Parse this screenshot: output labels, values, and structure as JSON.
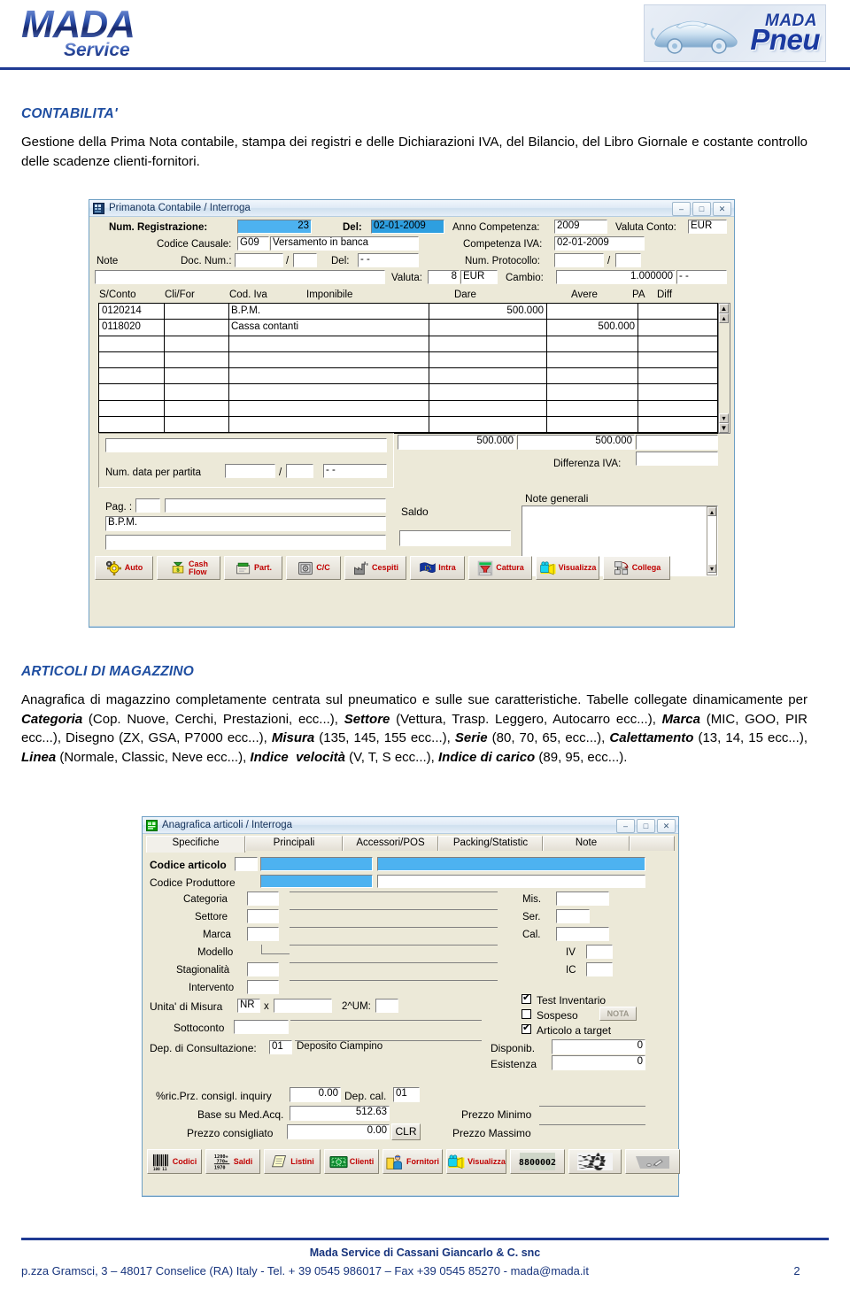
{
  "header": {
    "logo_left_main": "MADA",
    "logo_left_sub": "Service",
    "logo_right_top": "MADA",
    "logo_right_main": "Pneu",
    "car_icon": "sports-car-icon"
  },
  "sections": [
    {
      "id": "contabilita",
      "title": "CONTABILITA'",
      "body_html": "Gestione della Prima Nota contabile, stampa dei registri e delle Dichiarazioni IVA, del Bilancio, del Libro Giornale e costante controllo delle scadenze clienti-fornitori."
    },
    {
      "id": "articoli",
      "title": "ARTICOLI DI MAGAZZINO",
      "body_html": "Anagrafica di magazzino completamente centrata sul pneumatico e sulle sue caratteristiche. Tabelle collegate dinamicamente per <b>Categoria</b> (Cop. Nuove, Cerchi, Prestazioni, ecc...), <b>Settore</b> (Vettura, Trasp. Leggero, Autocarro ecc...), <b>Marca</b> (MIC, GOO, PIR ecc...), Disegno (ZX, GSA, P7000 ecc...), <b>Misura</b> (135, 145, 155 ecc...), <b>Serie</b> (80, 70, 65, ecc...), <b>Calettamento</b> (13, 14, 15 ecc...), <b>Linea</b> (Normale, Classic, Neve ecc...), <b>Indice&nbsp; velocit&agrave;</b> (V, T, S ecc...), <b>Indice di carico</b> (89, 95, ecc...)."
    }
  ],
  "window_primanota": {
    "title": "Primanota Contabile / Interroga",
    "window_icon": "app-grid-icon",
    "buttons": {
      "minimize": "–",
      "maximize": "□",
      "close": "✕"
    },
    "fields": {
      "num_registrazione_label": "Num. Registrazione:",
      "num_registrazione_value": "23",
      "del_label": "Del:",
      "del_value": "02-01-2009",
      "anno_competenza_label": "Anno Competenza:",
      "anno_competenza_value": "2009",
      "valuta_conto_label": "Valuta Conto:",
      "valuta_conto_value": "EUR",
      "codice_causale_label": "Codice Causale:",
      "codice_causale_code": "G09",
      "codice_causale_desc": "Versamento in banca",
      "competenza_iva_label": "Competenza IVA:",
      "competenza_iva_value": "02-01-2009",
      "note_label": "Note",
      "doc_num_label": "Doc. Num.:",
      "doc_num_value": "",
      "doc_num_slash": "/",
      "doc_num_value2": "",
      "doc_del_label": "Del:",
      "doc_del_value": "- -",
      "num_protocollo_label": "Num. Protocollo:",
      "num_protocollo_value": "",
      "num_protocollo_slash": "/",
      "num_protocollo_value2": "",
      "note_value": "",
      "valuta_label": "Valuta:",
      "valuta_num": "8",
      "valuta_code": "EUR",
      "cambio_label": "Cambio:",
      "cambio_value": "1.000000",
      "cambio_date": "- -"
    },
    "table": {
      "headers": [
        "S/Conto",
        "Cli/For",
        "Cod. Iva",
        "Imponibile",
        "Dare",
        "Avere",
        "PA",
        "Diff"
      ],
      "rows": [
        {
          "sconto": "0120214",
          "clifor": "",
          "codiva": "B.P.M.",
          "dare": "500.000",
          "avere": "",
          "pa": ""
        },
        {
          "sconto": "0118020",
          "clifor": "",
          "codiva": "Cassa contanti",
          "dare": "",
          "avere": "500.000",
          "pa": ""
        },
        {
          "sconto": "",
          "clifor": "",
          "codiva": "",
          "dare": "",
          "avere": "",
          "pa": ""
        },
        {
          "sconto": "",
          "clifor": "",
          "codiva": "",
          "dare": "",
          "avere": "",
          "pa": ""
        },
        {
          "sconto": "",
          "clifor": "",
          "codiva": "",
          "dare": "",
          "avere": "",
          "pa": ""
        },
        {
          "sconto": "",
          "clifor": "",
          "codiva": "",
          "dare": "",
          "avere": "",
          "pa": ""
        },
        {
          "sconto": "",
          "clifor": "",
          "codiva": "",
          "dare": "",
          "avere": "",
          "pa": ""
        },
        {
          "sconto": "",
          "clifor": "",
          "codiva": "",
          "dare": "",
          "avere": "",
          "pa": ""
        }
      ],
      "total_dare": "500.000",
      "total_avere": "500.000"
    },
    "footer_fields": {
      "num_data_partita_label": "Num. data per partita",
      "num_data_partita_v1": "",
      "num_data_partita_slash": "/",
      "num_data_partita_v2": "",
      "num_data_partita_date": "- -",
      "differenza_iva_label": "Differenza IVA:",
      "differenza_iva_value": "",
      "note_generali_label": "Note generali",
      "note_generali_value": "",
      "pag_label": "Pag. :",
      "pag_code": "",
      "pag_desc": "",
      "bpm_value": "B.P.M.",
      "extra_value": "",
      "saldo_label": "Saldo",
      "saldo_value": ""
    },
    "toolbar": [
      {
        "label": "Auto",
        "icon": "gear-icon"
      },
      {
        "label": "Cash Flow",
        "icon": "money-bag-icon"
      },
      {
        "label": "Part.",
        "icon": "card-file-icon"
      },
      {
        "label": "C/C",
        "icon": "safe-icon"
      },
      {
        "label": "Cespiti",
        "icon": "factory-icon"
      },
      {
        "label": "Intra",
        "icon": "eu-flag-icon"
      },
      {
        "label": "Cattura",
        "icon": "funnel-capture-icon"
      },
      {
        "label": "Visualizza",
        "icon": "camcorder-icon"
      },
      {
        "label": "Collega",
        "icon": "link-arrow-icon"
      }
    ]
  },
  "window_anagrafica": {
    "title": "Anagrafica articoli / Interroga",
    "window_icon": "green-card-icon",
    "buttons": {
      "minimize": "–",
      "maximize": "□",
      "close": "✕"
    },
    "tabs": [
      "Specifiche",
      "Principali",
      "Accessori/POS",
      "Packing/Statistic",
      "Note"
    ],
    "active_tab": "Specifiche",
    "fields": {
      "codice_articolo_label": "Codice articolo",
      "codice_articolo_v1": "",
      "codice_articolo_v2": "",
      "codice_articolo_v3": "",
      "codice_produttore_label": "Codice Produttore",
      "codice_produttore_v1": "",
      "codice_produttore_v2": "",
      "categoria_label": "Categoria",
      "settore_label": "Settore",
      "marca_label": "Marca",
      "modello_label": "Modello",
      "stagionalita_label": "Stagionalità",
      "intervento_label": "Intervento",
      "mis_label": "Mis.",
      "ser_label": "Ser.",
      "cal_label": "Cal.",
      "iv_label": "IV",
      "ic_label": "IC",
      "test_inventario_label": "Test Inventario",
      "test_inventario_checked": true,
      "sospeso_label": "Sospeso",
      "sospeso_checked": false,
      "nota_button_label": "NOTA",
      "articolo_target_label": "Articolo a target",
      "articolo_target_checked": true,
      "unita_misura_label": "Unita' di Misura",
      "unita_misura_value": "NR",
      "unita_misura_x": "x",
      "unita_misura_qty": "",
      "um2_label": "2^UM:",
      "um2_value": "",
      "sottoconto_label": "Sottoconto",
      "sottoconto_v1": "",
      "sottoconto_v2": "",
      "dep_consultazione_label": "Dep. di Consultazione:",
      "dep_consultazione_code": "01",
      "dep_consultazione_desc": "Deposito Ciampino",
      "disponib_label": "Disponib.",
      "disponib_value": "0",
      "esistenza_label": "Esistenza",
      "esistenza_value": "0",
      "ric_prz_label": "%ric.Prz. consigl. inquiry",
      "ric_prz_value": "0.00",
      "dep_cal_label": "Dep. cal.",
      "dep_cal_value": "01",
      "base_med_acq_label": "Base su Med.Acq.",
      "base_med_acq_value": "512.63",
      "prezzo_consigliato_label": "Prezzo consigliato",
      "prezzo_consigliato_value": "0.00",
      "clr_button_label": "CLR",
      "prezzo_minimo_label": "Prezzo Minimo",
      "prezzo_minimo_value": "",
      "prezzo_massimo_label": "Prezzo Massimo",
      "prezzo_massimo_value": ""
    },
    "toolbar": [
      {
        "label": "Codici",
        "icon": "barcode-icon"
      },
      {
        "label": "Saldi",
        "icon": "calculator-sum-icon"
      },
      {
        "label": "Listini",
        "icon": "price-list-icon"
      },
      {
        "label": "Clienti",
        "icon": "banknote-icon"
      },
      {
        "label": "Fornitori",
        "icon": "supplier-person-icon"
      },
      {
        "label": "Visualizza",
        "icon": "camcorder-icon"
      },
      {
        "label": "8800002",
        "icon": "barcode-number-icon"
      },
      {
        "label": "",
        "icon": "noise-image-icon"
      },
      {
        "label": "",
        "icon": "pen-draw-icon"
      }
    ]
  },
  "footer": {
    "company": "Mada Service di Cassani Giancarlo & C. snc",
    "address": "p.zza Gramsci, 3 – 48017 Conselice (RA) Italy - Tel. + 39 0545 986017 – Fax +39 0545 85270 - mada@mada.it",
    "page_number": "2"
  },
  "colors": {
    "brand_blue": "#1f3a93",
    "heading_blue": "#1f4ea1",
    "selection_blue": "#4db2f0",
    "window_face": "#ece9d8",
    "label_red": "#c00000"
  }
}
